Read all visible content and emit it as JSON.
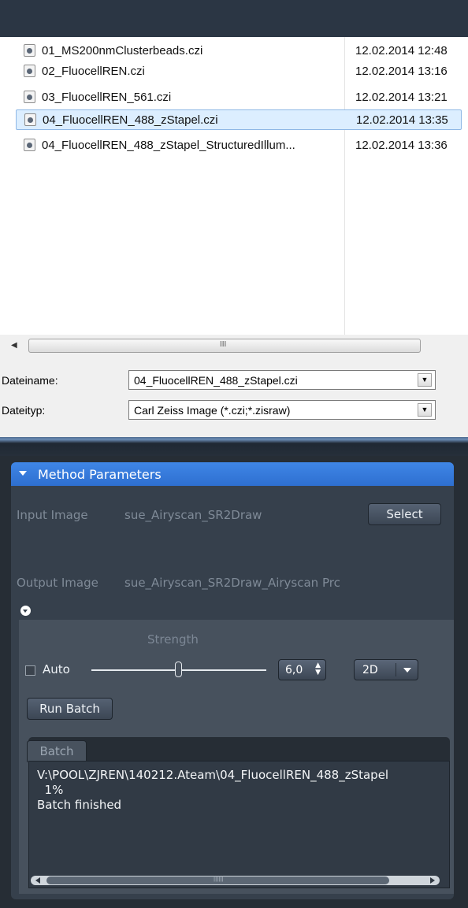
{
  "file_dialog": {
    "files": [
      {
        "name": "01_MS200nmClusterbeads.czi",
        "date": "12.02.2014 12:48",
        "selected": false
      },
      {
        "name": "02_FluocellREN.czi",
        "date": "12.02.2014 13:16",
        "selected": false
      },
      {
        "name": "03_FluocellREN_561.czi",
        "date": "12.02.2014 13:21",
        "selected": false
      },
      {
        "name": "04_FluocellREN_488_zStapel.czi",
        "date": "12.02.2014 13:35",
        "selected": true
      },
      {
        "name": "04_FluocellREN_488_zStapel_StructuredIllum...",
        "date": "12.02.2014 13:36",
        "selected": false
      }
    ],
    "hscroll_grip": "III",
    "filename_label": "Dateiname:",
    "filename_value": "04_FluocellREN_488_zStapel.czi",
    "filetype_label": "Dateityp:",
    "filetype_value": "Carl Zeiss Image (*.czi;*.zisraw)"
  },
  "method_parameters": {
    "title": "Method Parameters",
    "input_image_label": "Input Image",
    "input_image_value": "sue_Airyscan_SR2Draw",
    "select_button": "Select",
    "output_image_label": "Output Image",
    "output_image_value": "sue_Airyscan_SR2Draw_Airyscan Prc",
    "strength_label": "Strength",
    "auto_label": "Auto",
    "auto_checked": false,
    "strength_value": "6,0",
    "dimension_option": "2D",
    "run_batch_button": "Run Batch",
    "batch_tab": "Batch",
    "batch_log": "V:\\POOL\\ZJREN\\140212.Ateam\\04_FluocellREN_488_zStapel\n  1%\nBatch finished"
  }
}
